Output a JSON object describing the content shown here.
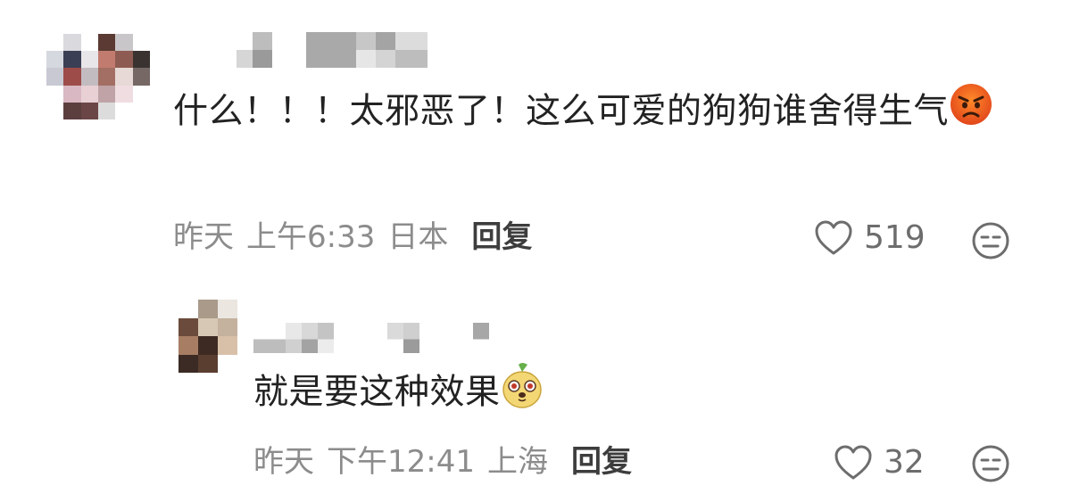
{
  "comments": [
    {
      "text": "什么！！！太邪恶了！这么可爱的狗狗谁舍得生气",
      "emoji": "angry-face",
      "date": "昨天",
      "time": "上午6:33",
      "location": "日本",
      "reply_label": "回复",
      "likes": "519"
    },
    {
      "text": "就是要这种效果",
      "emoji": "cartoon-sticker",
      "date": "昨天",
      "time": "下午12:41",
      "location": "上海",
      "reply_label": "回复",
      "likes": "32"
    }
  ],
  "colors": {
    "text": "#222222",
    "meta": "#8c8c8c",
    "reply": "#3d3d3d",
    "emoji_angry": "#f06a1a"
  }
}
